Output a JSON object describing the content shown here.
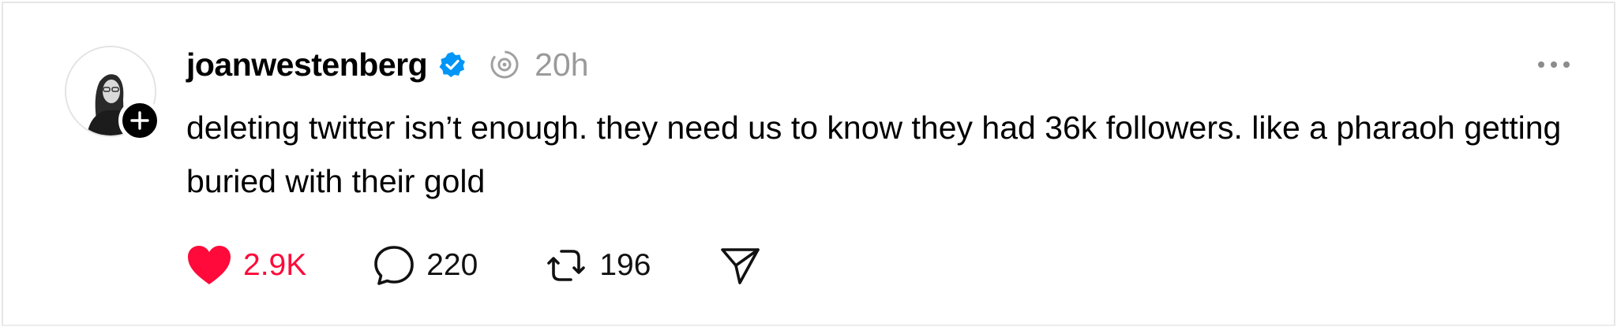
{
  "post": {
    "username": "joanwestenberg",
    "timestamp": "20h",
    "text": "deleting twitter isn’t enough. they need us to know they had 36k followers. like a pharaoh getting buried with their gold"
  },
  "actions": {
    "likes": "2.9K",
    "replies": "220",
    "reposts": "196"
  },
  "colors": {
    "like_red": "#ff0a3a",
    "verified_blue": "#0095f6",
    "muted_gray": "#9a9a9a"
  },
  "icons": {
    "verified": "verified-badge-icon",
    "thread": "thread-activity-icon",
    "more": "more-dots-icon",
    "like": "heart-icon",
    "reply": "comment-bubble-icon",
    "repost": "repost-icon",
    "share": "send-paper-plane-icon",
    "follow": "plus-icon"
  }
}
